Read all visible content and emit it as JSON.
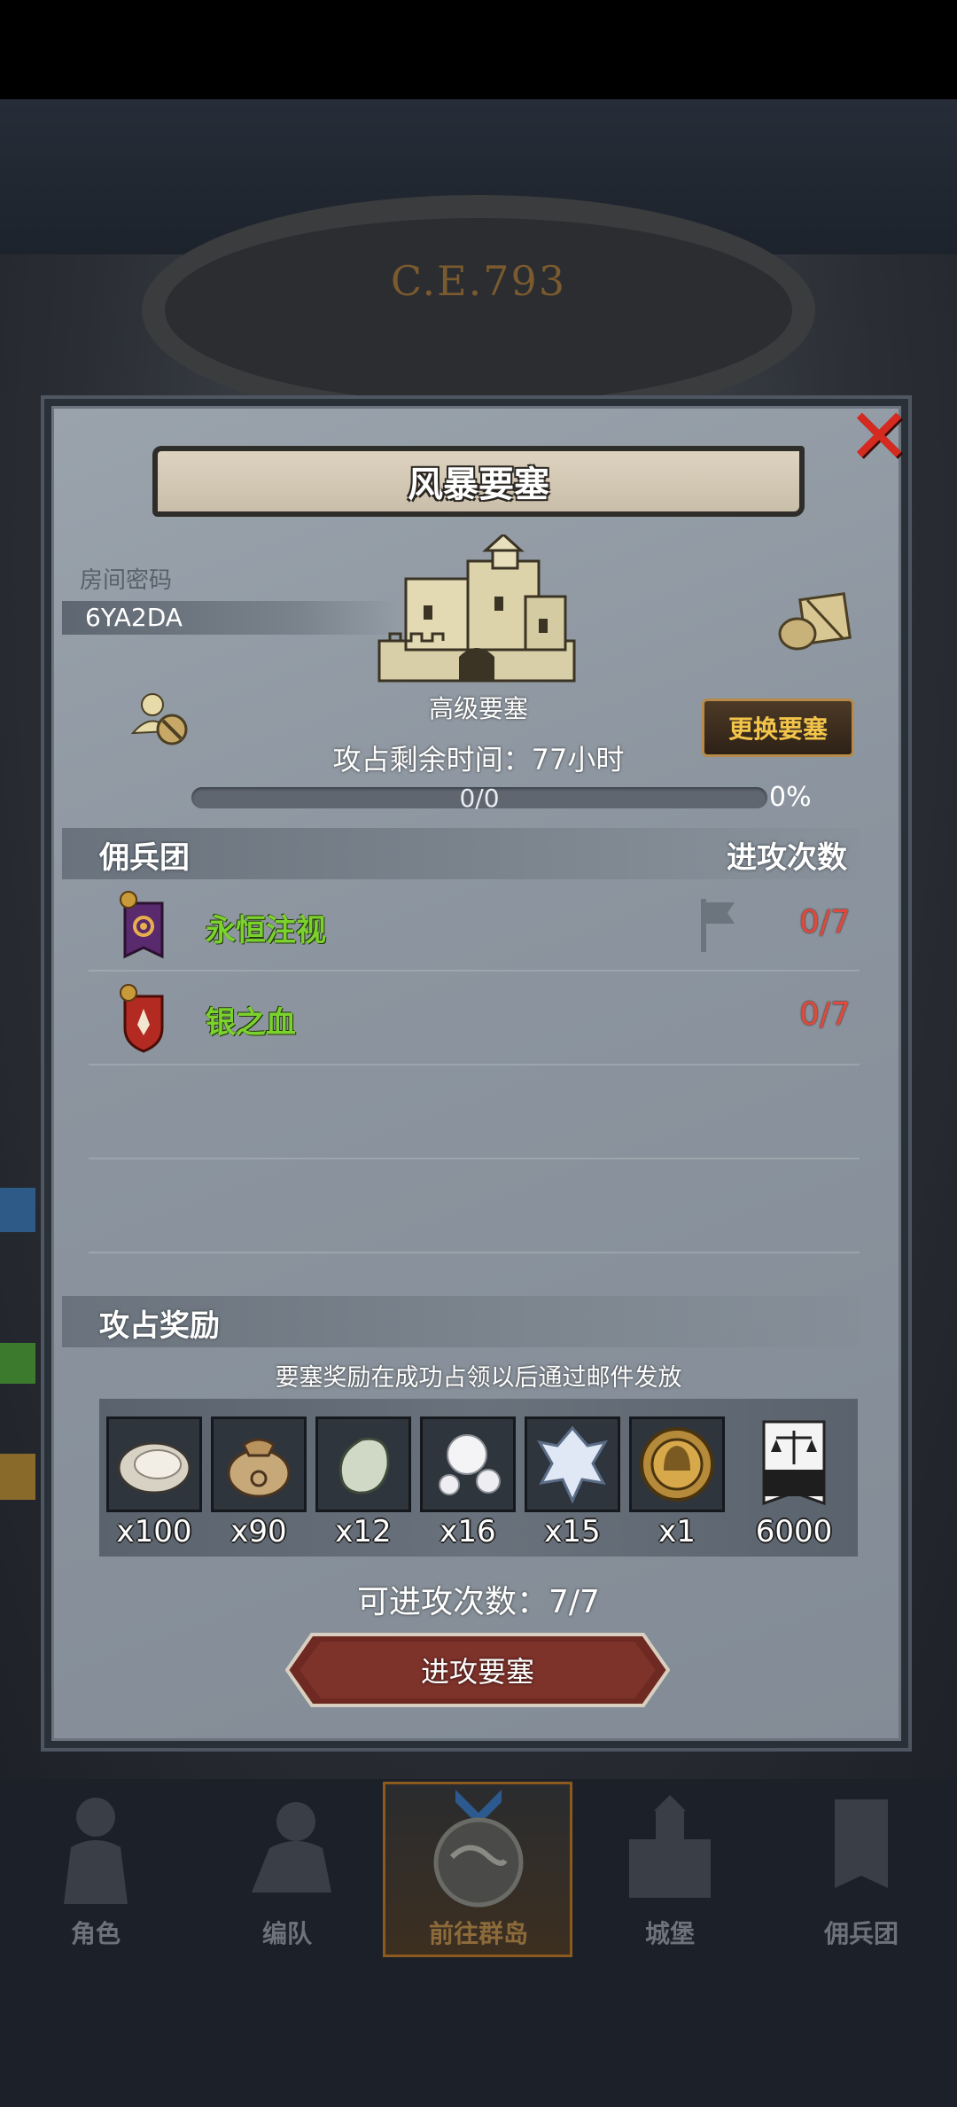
{
  "background": {
    "era_label": "C.E.793"
  },
  "dialog": {
    "title": "风暴要塞",
    "close_icon": "close-x-icon",
    "room": {
      "label": "房间密码",
      "code": "6YA2DA"
    },
    "fortress": {
      "level": "高级要塞",
      "change_button": "更换要塞"
    },
    "time_left": "攻占剩余时间：77小时",
    "progress": {
      "count": "0/0",
      "percent": "0%",
      "fraction": 0
    },
    "mercenary_section": {
      "title": "佣兵团",
      "attack_header": "进攻次数",
      "guilds": [
        {
          "name": "永恒注视",
          "count": "0/7",
          "emblem": "purple-eye-banner",
          "color": "#5a2a6e"
        },
        {
          "name": "银之血",
          "count": "0/7",
          "emblem": "red-flame-shield",
          "color": "#b32a22"
        }
      ]
    },
    "reward_section": {
      "title": "攻占奖励",
      "note": "要塞奖励在成功占领以后通过邮件发放",
      "items": [
        {
          "icon": "oyster-icon",
          "qty": "x100"
        },
        {
          "icon": "sack-icon",
          "qty": "x90"
        },
        {
          "icon": "jade-stone-icon",
          "qty": "x12"
        },
        {
          "icon": "pearls-icon",
          "qty": "x16"
        },
        {
          "icon": "crystal-icon",
          "qty": "x15"
        },
        {
          "icon": "helmet-medal-icon",
          "qty": "x1"
        },
        {
          "icon": "scales-banner-icon",
          "qty": "6000"
        }
      ]
    },
    "attacks_available": "可进攻次数：7/7",
    "attack_button": "进攻要塞"
  },
  "bottom_nav": {
    "items": [
      {
        "label": "角色",
        "icon": "knight-icon",
        "active": false
      },
      {
        "label": "编队",
        "icon": "formation-icon",
        "active": false
      },
      {
        "label": "前往群岛",
        "icon": "globe-icon",
        "active": true
      },
      {
        "label": "城堡",
        "icon": "castle-icon",
        "active": false
      },
      {
        "label": "佣兵团",
        "icon": "mercenary-icon",
        "active": false
      }
    ]
  },
  "colors": {
    "guild_name": "#7bd12e",
    "attack_count": "#e04a3c",
    "accent_gold": "#f2c44a",
    "close_red": "#d52a20"
  }
}
